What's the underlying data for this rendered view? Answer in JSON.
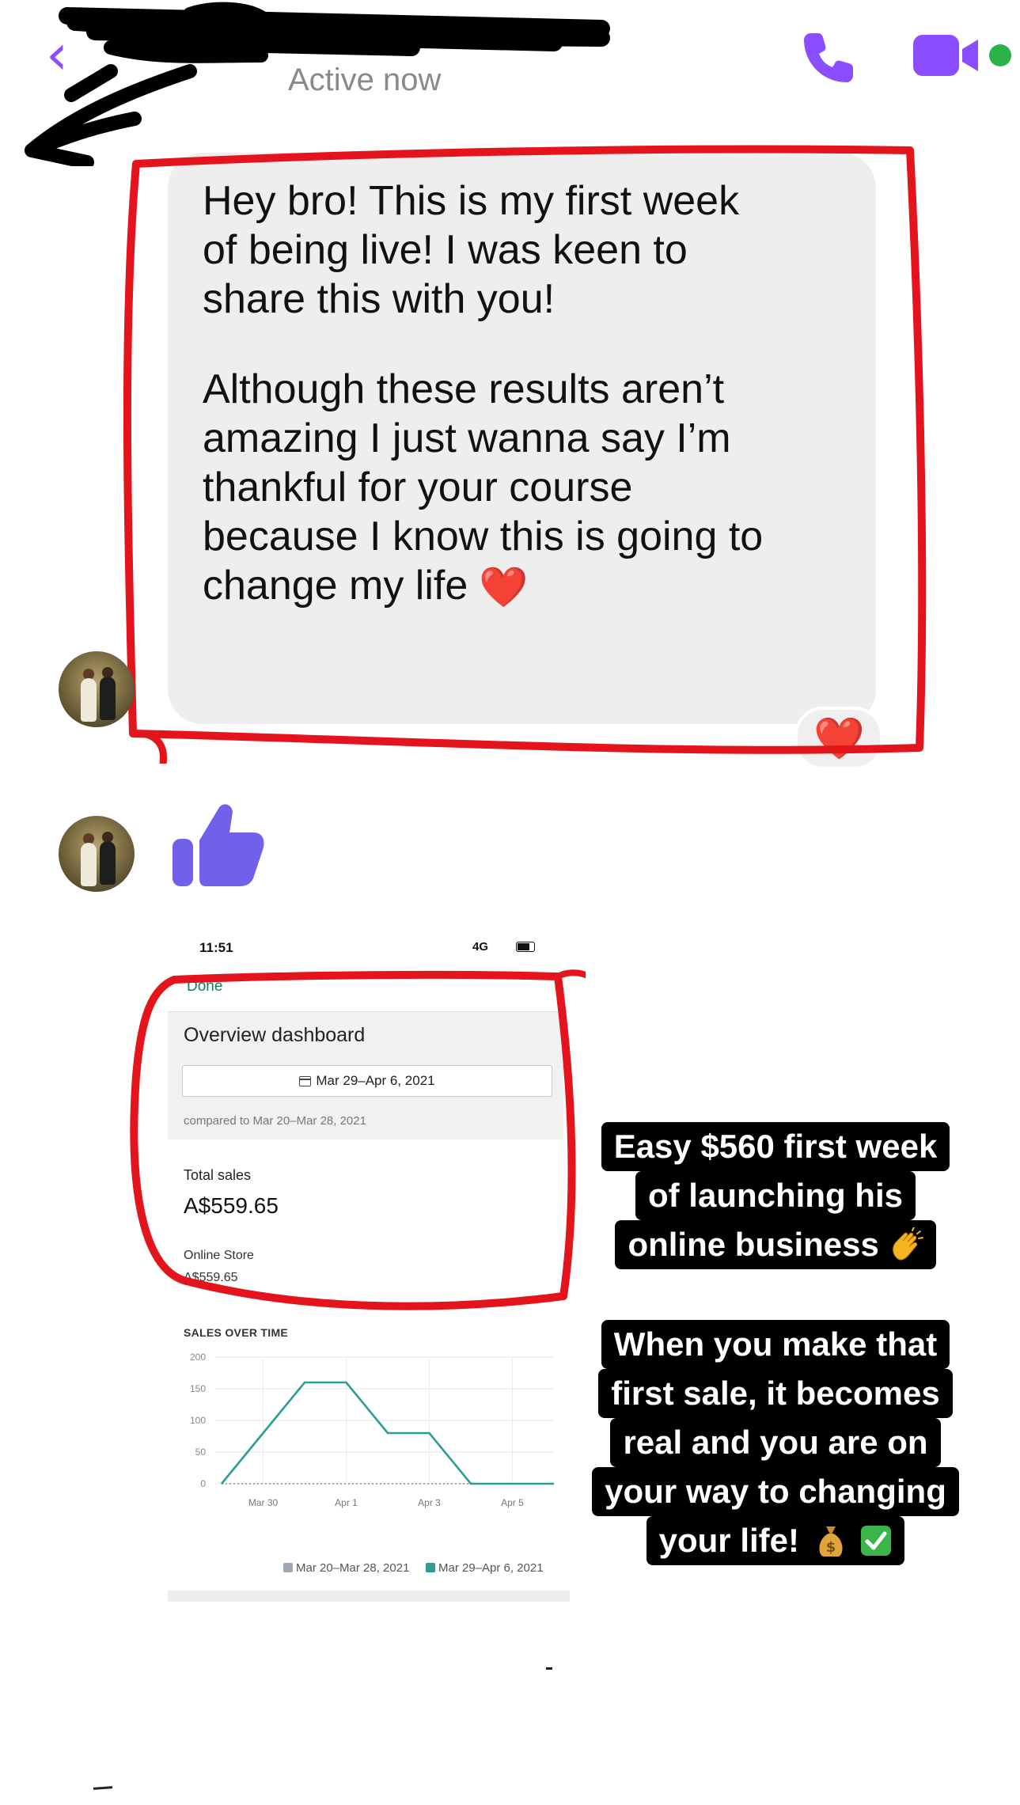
{
  "header": {
    "back_icon": "chevron-left-icon",
    "status_text": "Active now",
    "call_icon": "phone-icon",
    "video_icon": "video-camera-icon",
    "accent_color": "#8a4dff"
  },
  "message": {
    "lines_p1": [
      "Hey bro! This is my first week",
      "of being live! I was keen to",
      "share this with you!"
    ],
    "lines_p2": [
      "Although these results aren’t",
      "amazing I just wanna say I’m",
      "thankful for your course",
      "because I know this is going to",
      "change my life"
    ],
    "inline_emoji": "❤️",
    "reaction": "❤️",
    "bubble_color": "#eeeeef"
  },
  "thumbs_icon": "thumbs-up-icon",
  "dashboard": {
    "status_time": "11:51",
    "status_network": "4G",
    "done_label": "Done",
    "title": "Overview dashboard",
    "date_range": "Mar 29–Apr 6, 2021",
    "compared_text": "compared to Mar 20–Mar 28, 2021",
    "total_sales_label": "Total sales",
    "total_sales_value": "A$559.65",
    "online_store_label": "Online Store",
    "online_store_value": "A$559.65",
    "chart_title": "SALES OVER TIME",
    "legend": [
      {
        "label": "Mar 20–Mar 28, 2021",
        "color": "#a0a8b4"
      },
      {
        "label": "Mar 29–Apr 6, 2021",
        "color": "#2a9d94"
      }
    ]
  },
  "chart_data": {
    "type": "line",
    "title": "SALES OVER TIME",
    "x": [
      "Mar 29",
      "Mar 30",
      "Mar 31",
      "Apr 1",
      "Apr 2",
      "Apr 3",
      "Apr 4",
      "Apr 5",
      "Apr 6"
    ],
    "x_tick_labels": [
      "Mar 30",
      "Apr 1",
      "Apr 3",
      "Apr 5"
    ],
    "y_ticks": [
      0,
      50,
      100,
      150,
      200
    ],
    "ylim": [
      0,
      200
    ],
    "grid": true,
    "legend_position": "bottom",
    "series": [
      {
        "name": "Mar 20–Mar 28, 2021",
        "values": [
          0,
          0,
          0,
          0,
          0,
          0,
          0,
          0,
          0
        ],
        "color": "#a0a8b4",
        "style": "dotted"
      },
      {
        "name": "Mar 29–Apr 6, 2021",
        "values": [
          0,
          80,
          160,
          160,
          80,
          80,
          0,
          0,
          0
        ],
        "color": "#2a9d94",
        "style": "solid"
      }
    ]
  },
  "captions": {
    "caption1": [
      "Easy $560 first week",
      "of launching his",
      "online business"
    ],
    "caption1_emoji": "clapping-hands-icon",
    "caption2": [
      "When you make that",
      "first sale, it becomes",
      "real and you are on",
      "your way to changing",
      "your life!"
    ],
    "caption2_emojis": [
      "money-bag-icon",
      "check-mark-icon"
    ]
  },
  "colors": {
    "highlight_red": "#e3141b",
    "caption_bg": "#000000"
  }
}
